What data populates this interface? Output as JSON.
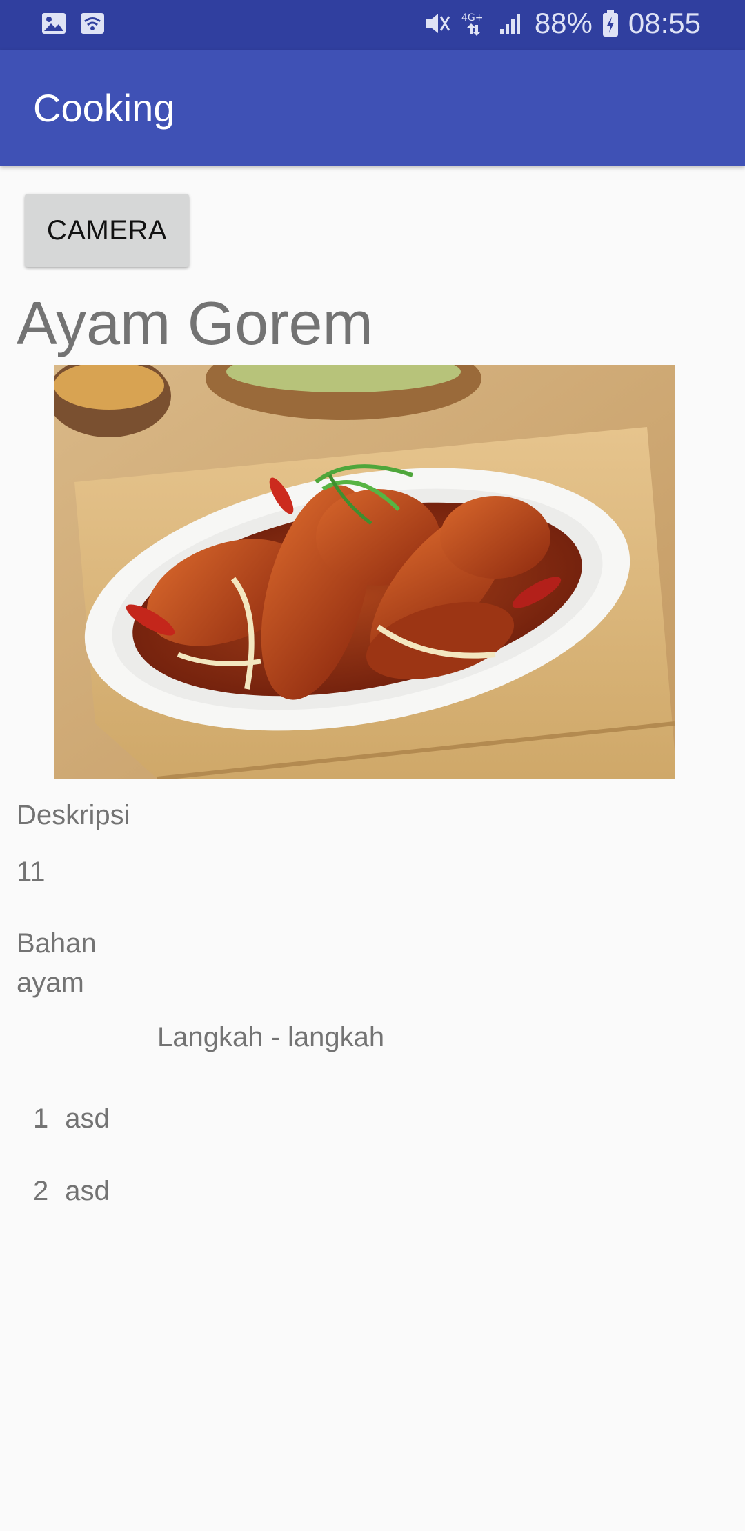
{
  "status_bar": {
    "battery": "88%",
    "time": "08:55",
    "network": "4G+",
    "icons": [
      "image-icon",
      "wifi-icon",
      "mute-icon",
      "network-4g-icon",
      "signal-icon",
      "battery-charging-icon"
    ]
  },
  "app_bar": {
    "title": "Cooking"
  },
  "camera_button": {
    "label": "CAMERA"
  },
  "recipe": {
    "title": "Ayam Gorem",
    "description_label": "Deskripsi",
    "description_value": "11",
    "bahan_label": "Bahan",
    "bahan_value": "ayam",
    "steps_header": "Langkah - langkah",
    "steps": [
      {
        "number": "1",
        "text": "asd"
      },
      {
        "number": "2",
        "text": "asd"
      }
    ]
  },
  "colors": {
    "status_bar": "#303f9f",
    "app_bar": "#3f51b5",
    "background": "#fafafa",
    "button": "#d6d7d7",
    "text_secondary": "#737373"
  }
}
